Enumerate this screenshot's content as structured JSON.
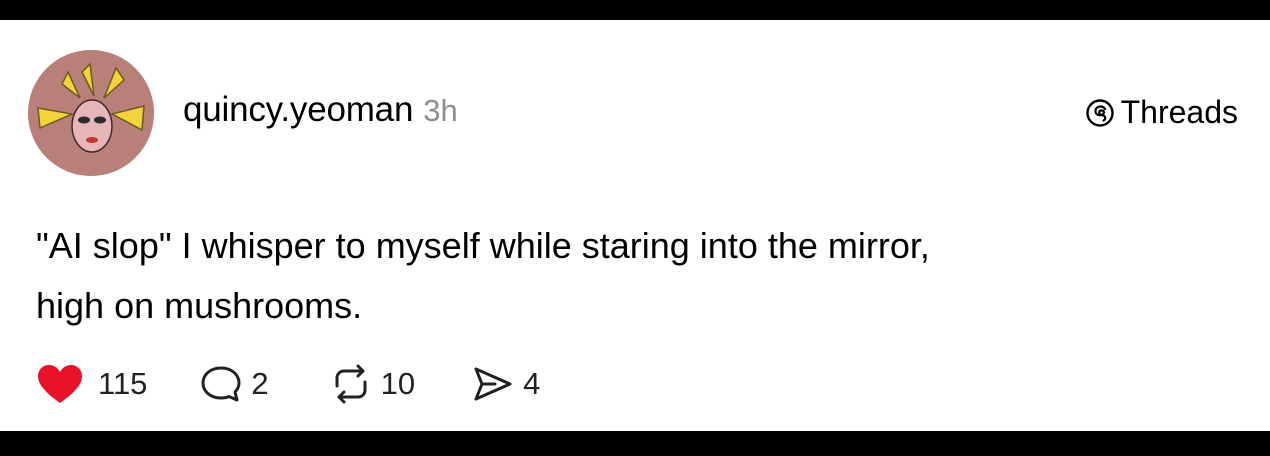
{
  "post": {
    "username": "quincy.yeoman",
    "timestamp": "3h",
    "brand_label": "Threads",
    "text_lines": [
      "\"AI slop\" I whisper to myself while staring into the mirror,",
      "high on mushrooms."
    ]
  },
  "actions": {
    "likes": "115",
    "replies": "2",
    "reposts": "10",
    "shares": "4"
  },
  "icons": {
    "avatar": "avatar-illustration",
    "brand": "threads-logo-icon",
    "like": "heart-icon",
    "reply": "comment-bubble-icon",
    "repost": "repost-arrows-icon",
    "share": "send-icon"
  },
  "colors": {
    "heart": "#e8132b",
    "timestamp": "#8e8e8e",
    "avatar_bg": "#b98079"
  }
}
